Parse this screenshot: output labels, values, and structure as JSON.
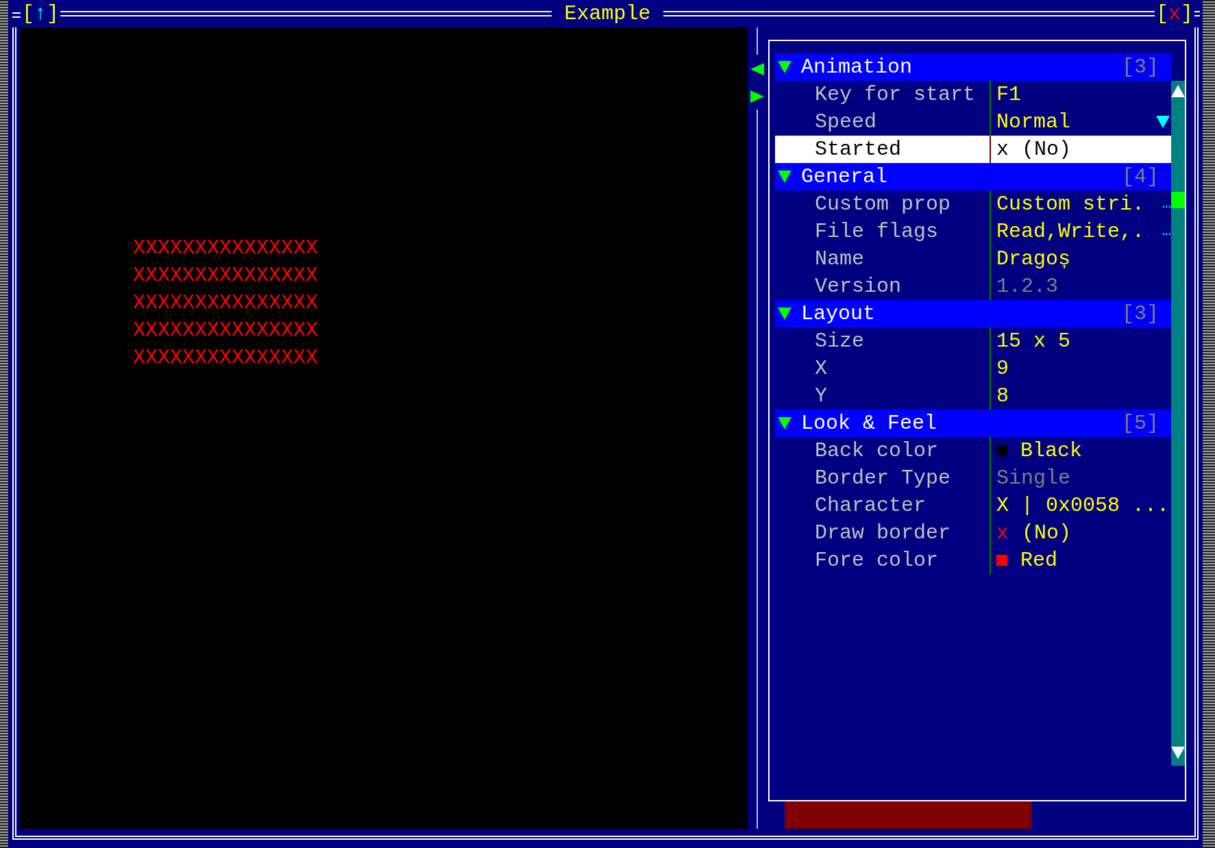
{
  "window": {
    "title": "Example",
    "left_button": {
      "open": "[",
      "glyph": "↑",
      "close": "]"
    },
    "close_button": {
      "open": "[",
      "glyph": "x",
      "close": "]"
    }
  },
  "canvas": {
    "lines": [
      "XXXXXXXXXXXXXXX",
      "XXXXXXXXXXXXXXX",
      "XXXXXXXXXXXXXXX",
      "XXXXXXXXXXXXXXX",
      "XXXXXXXXXXXXXXX"
    ]
  },
  "property_grid": {
    "categories": [
      {
        "name": "Animation",
        "count": "[3]",
        "expanded": true,
        "properties": [
          {
            "kind": "text",
            "name": "Key for start",
            "value": "F1",
            "selected": false,
            "disabled": false
          },
          {
            "kind": "dropdown",
            "name": "Speed",
            "value": "Normal",
            "selected": false,
            "disabled": false
          },
          {
            "kind": "bool",
            "name": "Started",
            "mark": "x",
            "value": "(No)",
            "checked": false,
            "selected": true,
            "disabled": false
          }
        ]
      },
      {
        "name": "General",
        "count": "[4]",
        "expanded": true,
        "properties": [
          {
            "kind": "ellipsis",
            "name": "Custom prop",
            "value": "Custom stri.",
            "more": "…",
            "selected": false,
            "disabled": false
          },
          {
            "kind": "ellipsis",
            "name": "File flags",
            "value": "Read,Write,.",
            "more": "…",
            "selected": false,
            "disabled": false
          },
          {
            "kind": "text",
            "name": "Name",
            "value": "Dragoș",
            "selected": false,
            "disabled": false
          },
          {
            "kind": "text",
            "name": "Version",
            "value": "1.2.3",
            "selected": false,
            "disabled": true
          }
        ]
      },
      {
        "name": "Layout",
        "count": "[3]",
        "expanded": true,
        "properties": [
          {
            "kind": "text",
            "name": "Size",
            "value": "15 x 5",
            "selected": false,
            "disabled": false
          },
          {
            "kind": "text",
            "name": "X",
            "value": "9",
            "selected": false,
            "disabled": false
          },
          {
            "kind": "text",
            "name": "Y",
            "value": "8",
            "selected": false,
            "disabled": false
          }
        ]
      },
      {
        "name": "Look & Feel",
        "count": "[5]",
        "expanded": true,
        "properties": [
          {
            "kind": "color",
            "name": "Back color",
            "color": "#000000",
            "value": "Black",
            "selected": false,
            "disabled": false
          },
          {
            "kind": "text",
            "name": "Border Type",
            "value": "Single",
            "selected": false,
            "disabled": true
          },
          {
            "kind": "text",
            "name": "Character",
            "value": "X | 0x0058 ...",
            "selected": false,
            "disabled": false
          },
          {
            "kind": "bool",
            "name": "Draw border",
            "mark": "x",
            "value": "(No)",
            "checked": false,
            "selected": false,
            "disabled": false
          },
          {
            "kind": "color",
            "name": "Fore color",
            "color": "#ff0000",
            "value": "Red",
            "selected": false,
            "disabled": false
          }
        ]
      }
    ]
  }
}
